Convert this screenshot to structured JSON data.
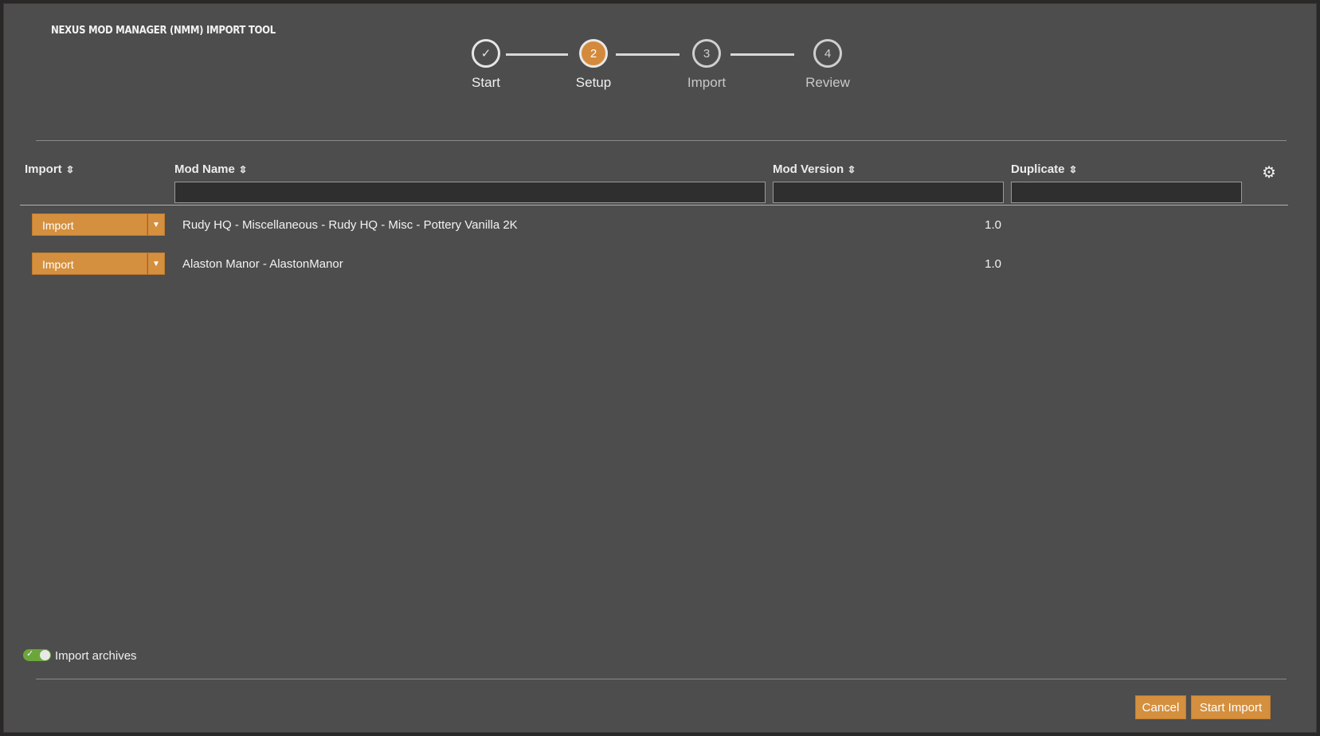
{
  "app": {
    "title": "NEXUS MOD MANAGER (NMM) IMPORT TOOL"
  },
  "stepper": {
    "steps": [
      {
        "label": "Start",
        "state": "done",
        "marker": "✓"
      },
      {
        "label": "Setup",
        "state": "active",
        "marker": "2"
      },
      {
        "label": "Import",
        "state": "pending",
        "marker": "3"
      },
      {
        "label": "Review",
        "state": "pending",
        "marker": "4"
      }
    ]
  },
  "table": {
    "columns": [
      {
        "label": "Import",
        "sort_icon": "sort-icon"
      },
      {
        "label": "Mod Name",
        "sort_icon": "sort-icon"
      },
      {
        "label": "Mod Version",
        "sort_icon": "sort-icon"
      },
      {
        "label": "Duplicate",
        "sort_icon": "sort-icon"
      }
    ],
    "filters": {
      "mod_name": "",
      "mod_version": "",
      "duplicate": ""
    },
    "settings_icon": "gear-icon",
    "rows": [
      {
        "import": "Import",
        "mod_name": "Rudy HQ - Miscellaneous - Rudy HQ - Misc - Pottery Vanilla 2K",
        "mod_version": "1.0",
        "duplicate": ""
      },
      {
        "import": "Import",
        "mod_name": "Alaston Manor - AlastonManor",
        "mod_version": "1.0",
        "duplicate": ""
      }
    ]
  },
  "footer": {
    "toggle_label": "Import archives",
    "toggle_on": true,
    "cancel_label": "Cancel",
    "start_label": "Start Import"
  },
  "colors": {
    "accent": "#d4903f",
    "background": "#4d4d4d",
    "toggle_on": "#6ba63c"
  }
}
